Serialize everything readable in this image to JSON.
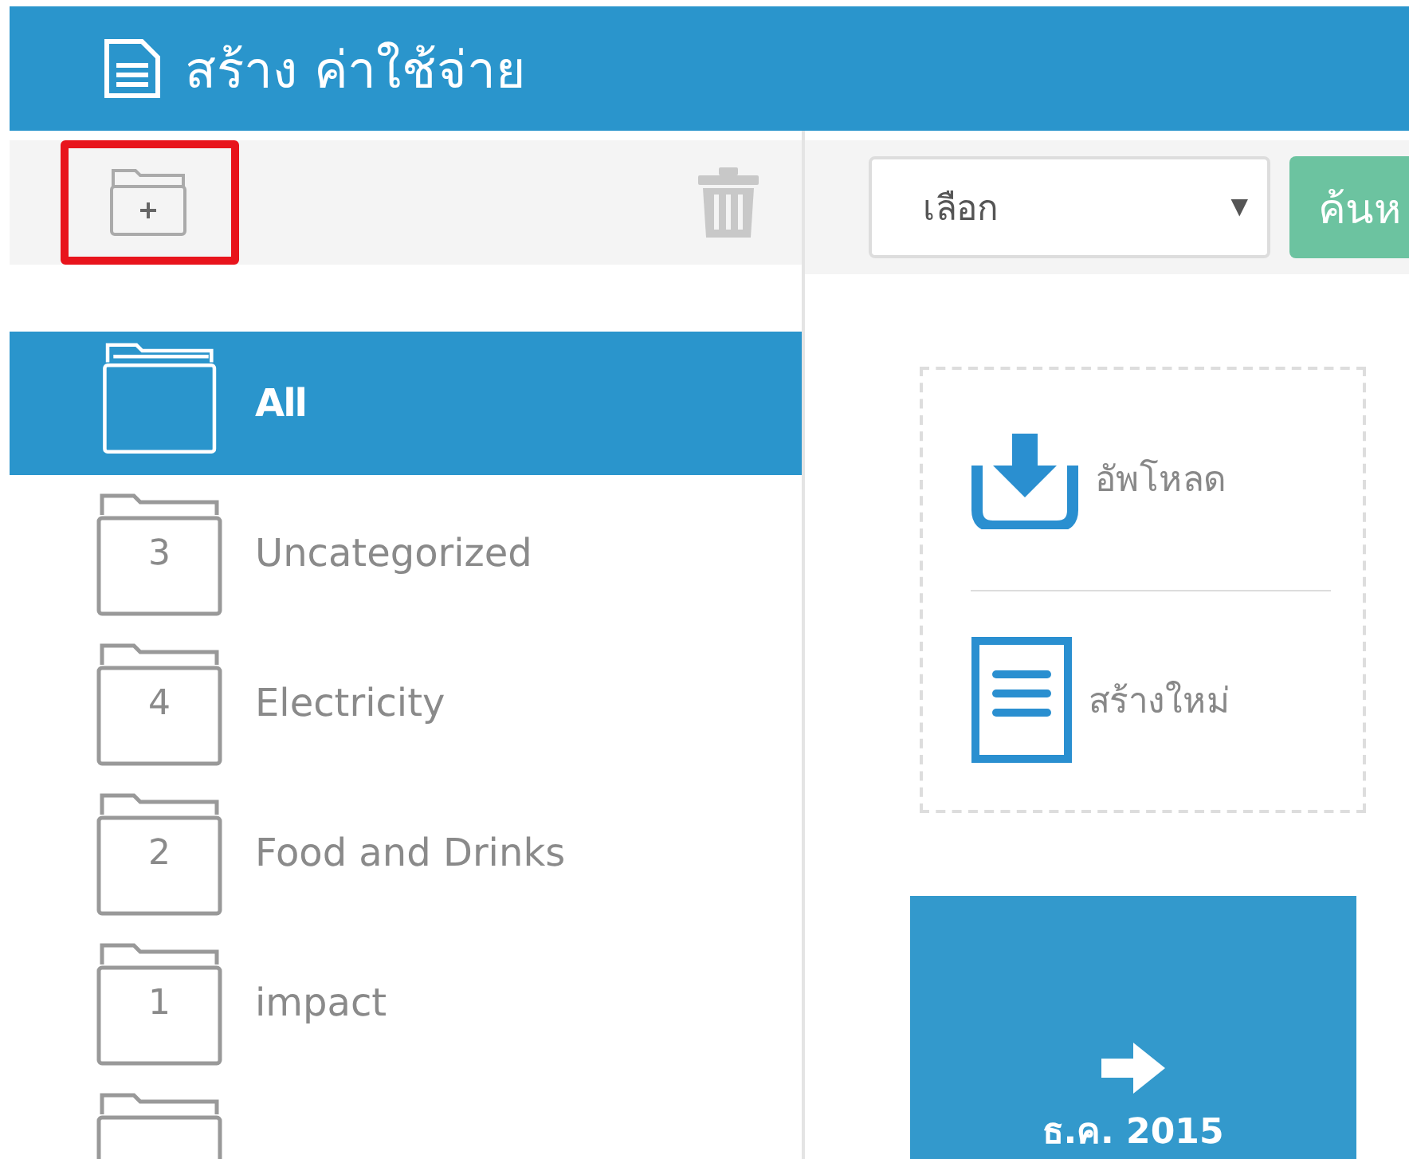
{
  "header": {
    "title": "สร้าง ค่าใช้จ่าย"
  },
  "sidebar": {
    "toolbar": {
      "add_folder_highlighted": true
    },
    "folders": [
      {
        "kind": "all",
        "label": "All",
        "selected": true
      },
      {
        "kind": "folder",
        "count": "3",
        "label": "Uncategorized",
        "selected": false
      },
      {
        "kind": "folder",
        "count": "4",
        "label": "Electricity",
        "selected": false
      },
      {
        "kind": "folder",
        "count": "2",
        "label": "Food and Drinks",
        "selected": false
      },
      {
        "kind": "folder",
        "count": "1",
        "label": "impact",
        "selected": false
      },
      {
        "kind": "partial",
        "selected": false
      }
    ]
  },
  "main": {
    "filter": {
      "value": "เลือก",
      "caret": "▼"
    },
    "search_button": "ค้นห",
    "actions": [
      {
        "kind": "upload",
        "label": "อัพโหลด"
      },
      {
        "kind": "new",
        "label": "สร้างใหม่"
      }
    ],
    "period_tile": {
      "label": "ธ.ค. 2015"
    }
  }
}
